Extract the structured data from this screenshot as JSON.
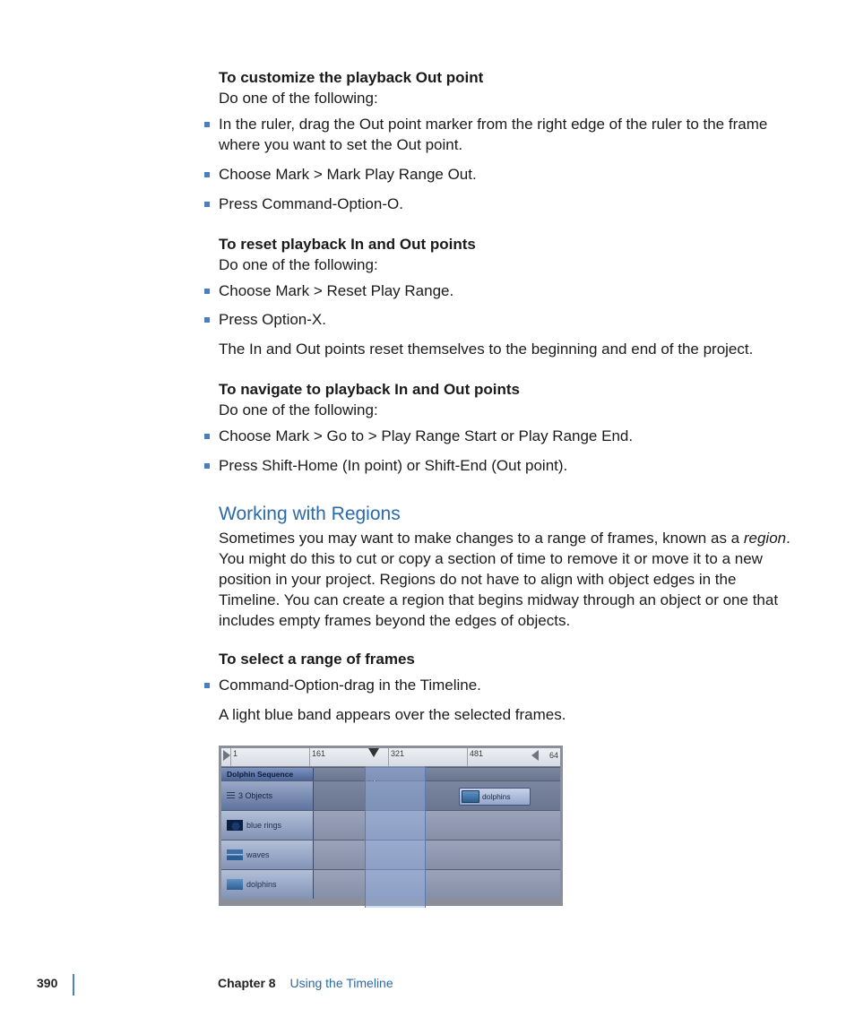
{
  "sections": {
    "customize": {
      "heading": "To customize the playback Out point",
      "lead": "Do one of the following:",
      "items": [
        "In the ruler, drag the Out point marker from the right edge of the ruler to the frame where you want to set the Out point.",
        "Choose Mark > Mark Play Range Out.",
        "Press Command-Option-O."
      ]
    },
    "reset": {
      "heading": "To reset playback In and Out points",
      "lead": "Do one of the following:",
      "items": [
        "Choose Mark > Reset Play Range.",
        "Press Option-X."
      ],
      "note": "The In and Out points reset themselves to the beginning and end of the project."
    },
    "navigate": {
      "heading": "To navigate to playback In and Out points",
      "lead": "Do one of the following:",
      "items": [
        "Choose Mark > Go to > Play Range Start or Play Range End.",
        "Press Shift-Home (In point) or Shift-End (Out point)."
      ]
    },
    "regions": {
      "title": "Working with Regions",
      "para_pre": "Sometimes you may want to make changes to a range of frames, known as a ",
      "para_em": "region",
      "para_post": ". You might do this to cut or copy a section of time to remove it or move it to a new position in your project. Regions do not have to align with object edges in the Timeline. You can create a region that begins midway through an object or one that includes empty frames beyond the edges of objects.",
      "subheading": "To select a range of frames",
      "items": [
        "Command-Option-drag in the Timeline."
      ],
      "result": "A light blue band appears over the selected frames."
    }
  },
  "timeline": {
    "ruler_ticks": [
      "1",
      "161",
      "321",
      "481"
    ],
    "ruler_end": "64",
    "group_label": "Dolphin Sequence",
    "objects_label": "3 Objects",
    "tracks": {
      "blue_rings": "blue rings",
      "waves": "waves",
      "dolphins_track": "dolphins",
      "dolphins_clip": "dolphins"
    }
  },
  "footer": {
    "page": "390",
    "chapter": "Chapter 8",
    "title": "Using the Timeline"
  }
}
